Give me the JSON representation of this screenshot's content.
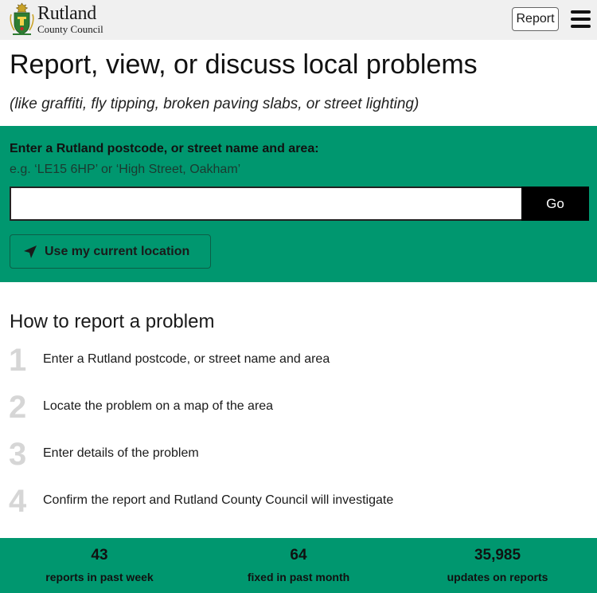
{
  "header": {
    "logo_name": "Rutland",
    "logo_sub": "County Council",
    "report_label": "Report"
  },
  "hero": {
    "title": "Report, view, or discuss local problems",
    "subtitle": "(like graffiti, fly tipping, broken paving slabs, or street lighting)"
  },
  "search": {
    "label": "Enter a Rutland postcode, or street name and area:",
    "hint": "e.g. ‘LE15 6HP’ or ‘High Street, Oakham’",
    "value": "",
    "go_label": "Go",
    "location_label": "Use my current location"
  },
  "how": {
    "title": "How to report a problem",
    "steps": [
      {
        "num": "1",
        "text": "Enter a Rutland postcode, or street name and area"
      },
      {
        "num": "2",
        "text": "Locate the problem on a map of the area"
      },
      {
        "num": "3",
        "text": "Enter details of the problem"
      },
      {
        "num": "4",
        "text": "Confirm the report and Rutland County Council will investigate"
      }
    ]
  },
  "stats": [
    {
      "value": "43",
      "label": "reports in past week"
    },
    {
      "value": "64",
      "label": "fixed in past month"
    },
    {
      "value": "35,985",
      "label": "updates on reports"
    }
  ],
  "colors": {
    "accent": "#00976f",
    "topbar": "#f0f0f0"
  },
  "icons": {
    "logo": "county-crest-icon",
    "menu": "hamburger-menu-icon",
    "location": "location-arrow-icon"
  }
}
